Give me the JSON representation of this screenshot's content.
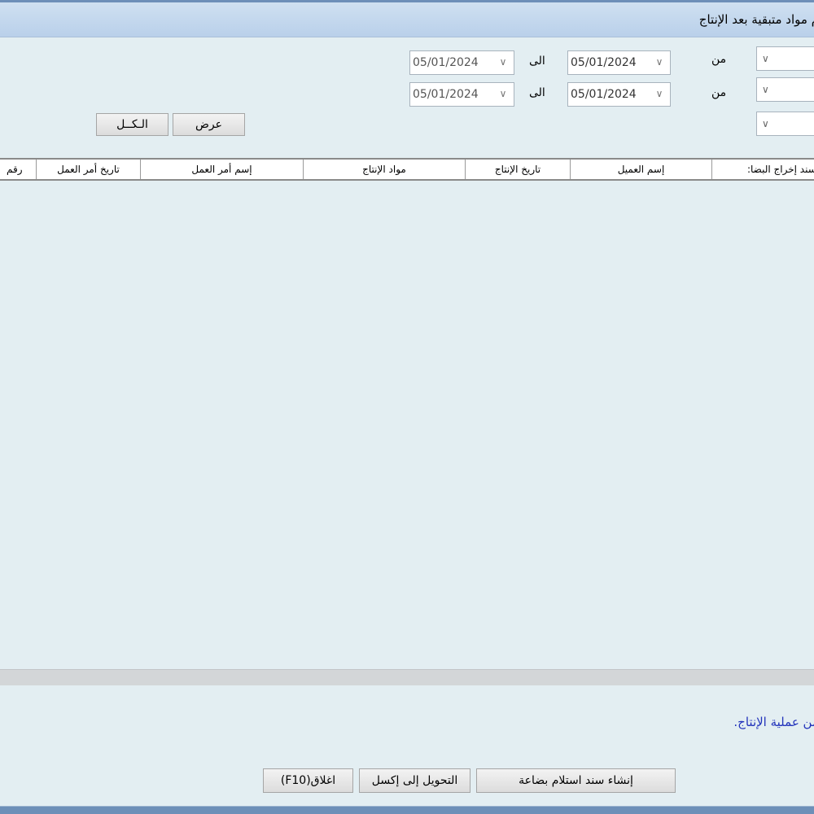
{
  "window": {
    "title": "م مواد متبقية بعد الإنتاج"
  },
  "filters": {
    "from_label": "من",
    "to_label": "الى",
    "row1": {
      "from_date": "05/01/2024",
      "to_date": "05/01/2024"
    },
    "row2": {
      "from_date": "05/01/2024",
      "to_date": "05/01/2024"
    }
  },
  "buttons": {
    "view": "عرض",
    "all": "الـكــل",
    "create_receipt": "إنشاء سند استلام بضاعة",
    "export_excel": "التحويل إلى إكسل",
    "close": "اغلاق(F10)"
  },
  "grid": {
    "columns": [
      "م سند إخراج البضا:",
      "إسم العميل",
      "تاريخ الإنتاج",
      "مواد الإنتاج",
      "إسم أمر العمل",
      "تاريخ أمر العمل",
      "رقم"
    ]
  },
  "footer": {
    "note": "من عملية الإنتاج."
  },
  "icons": {
    "dropdown": "chevron-down-icon"
  }
}
